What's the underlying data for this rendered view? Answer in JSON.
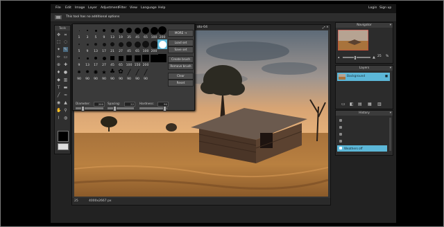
{
  "menu": {
    "items": [
      "File",
      "Edit",
      "Image",
      "Layer",
      "Adjustment",
      "Filter",
      "View",
      "Language",
      "Help"
    ],
    "login": "Login",
    "signup": "Sign up"
  },
  "options_bar": {
    "message": "This tool has no additional options"
  },
  "tools_panel": {
    "title": "Tools"
  },
  "document": {
    "title": "oto-04",
    "zoom": "25",
    "dimensions": "4000x2667 px"
  },
  "brush_picker": {
    "rows": [
      [
        "1",
        "3",
        "5",
        "9",
        "13",
        "19",
        "5",
        "9",
        "13",
        "17",
        "21",
        "27"
      ],
      [
        "35",
        "45",
        "65",
        "100",
        "200"
      ],
      [
        "9",
        "13",
        "19",
        "17",
        "45",
        "65",
        "100",
        "200"
      ],
      [
        "9",
        "13",
        "17",
        "27",
        "45",
        "65",
        "100",
        "150",
        "200"
      ],
      [
        "90",
        "90",
        "90",
        "90",
        "90",
        "90",
        "90",
        "90",
        "90"
      ]
    ],
    "row1_labels": [
      "1",
      "3",
      "5",
      "9",
      "13",
      "19",
      "35",
      "45",
      "65",
      "100",
      "200"
    ],
    "row2_labels": [
      "5",
      "9",
      "13",
      "17",
      "21",
      "27",
      "45",
      "65",
      "100",
      "200",
      ""
    ],
    "row3_labels": [
      "9",
      "13",
      "19",
      "17",
      "45",
      "65",
      "100",
      "200",
      ""
    ],
    "row4_labels": [
      "9",
      "13",
      "17",
      "27",
      "45",
      "65",
      "100",
      "150",
      "200"
    ],
    "row5_labels": [
      "9",
      "",
      "",
      "",
      "",
      "",
      "",
      "",
      "",
      "",
      "45"
    ],
    "row6_labels": [
      "90",
      "90",
      "90",
      "90",
      "90",
      "90",
      "90",
      "90",
      "90"
    ],
    "buttons": {
      "more": "MORE →",
      "load": "Load set",
      "save": "Save set",
      "create": "Create brush",
      "remove": "Remove brush",
      "clear": "Clear",
      "reset": "Reset"
    },
    "diameter_label": "Diameter:",
    "diameter_value": "200",
    "spacing_label": "Spacing:",
    "spacing_value": "22",
    "hardness_label": "Hardness:",
    "hardness_value": "90",
    "selected_brush": "200"
  },
  "navigator": {
    "title": "Navigator",
    "zoom_value": "25",
    "zoom_unit": "%"
  },
  "layers": {
    "title": "Layers",
    "items": [
      "Background"
    ]
  },
  "history": {
    "title": "History",
    "items": [
      "",
      "",
      "",
      "",
      "Weathers off"
    ],
    "selected_index": 4
  },
  "colors": {
    "accent": "#5cb7d8",
    "panel_bg": "#2c2c2c",
    "menubar_bg": "#151515"
  }
}
